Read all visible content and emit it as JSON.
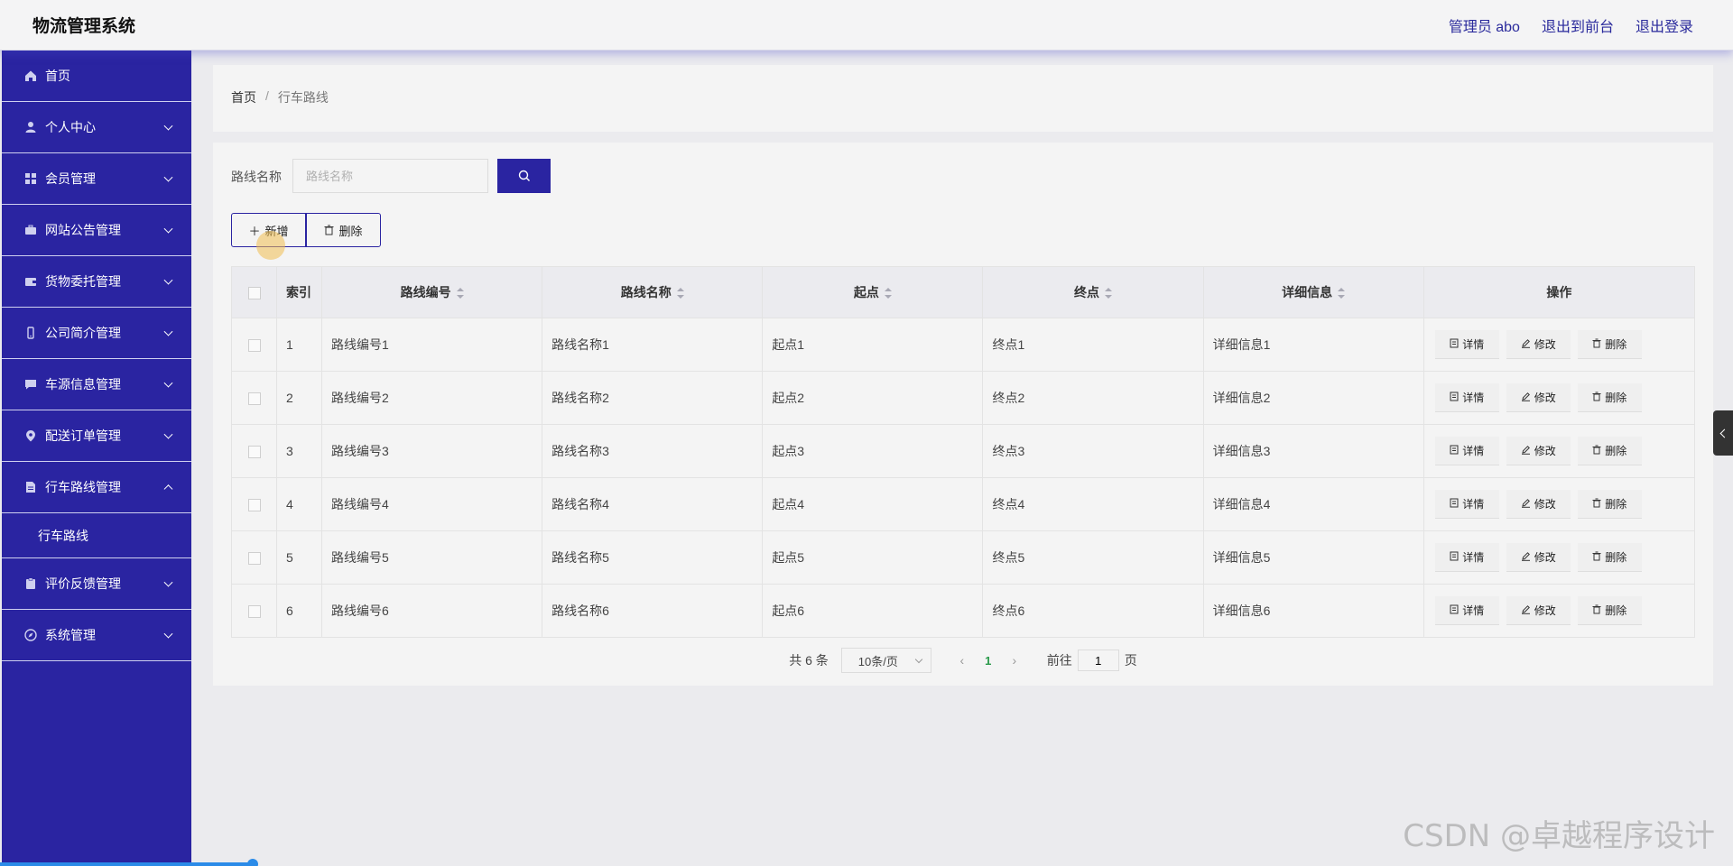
{
  "app": {
    "title": "物流管理系统"
  },
  "header": {
    "admin_label": "管理员 abo",
    "front_link": "退出到前台",
    "logout_link": "退出登录"
  },
  "sidebar": {
    "items": [
      {
        "label": "首页",
        "icon": "home-icon",
        "chevron": "none"
      },
      {
        "label": "个人中心",
        "icon": "user-icon",
        "chevron": "down"
      },
      {
        "label": "会员管理",
        "icon": "grid-icon",
        "chevron": "down"
      },
      {
        "label": "网站公告管理",
        "icon": "briefcase-icon",
        "chevron": "down"
      },
      {
        "label": "货物委托管理",
        "icon": "wallet-icon",
        "chevron": "down"
      },
      {
        "label": "公司简介管理",
        "icon": "phone-icon",
        "chevron": "down"
      },
      {
        "label": "车源信息管理",
        "icon": "message-icon",
        "chevron": "down"
      },
      {
        "label": "配送订单管理",
        "icon": "location-icon",
        "chevron": "down"
      },
      {
        "label": "行车路线管理",
        "icon": "document-icon",
        "chevron": "up"
      },
      {
        "label": "评价反馈管理",
        "icon": "clipboard-icon",
        "chevron": "down"
      },
      {
        "label": "系统管理",
        "icon": "compass-icon",
        "chevron": "down"
      }
    ],
    "submenu": {
      "label": "行车路线"
    }
  },
  "breadcrumb": {
    "home": "首页",
    "separator": "/",
    "current": "行车路线"
  },
  "search": {
    "label": "路线名称",
    "placeholder": "路线名称",
    "value": ""
  },
  "actions": {
    "add_label": "新增",
    "delete_label": "删除"
  },
  "table": {
    "headers": {
      "index": "索引",
      "route_no": "路线编号",
      "route_name": "路线名称",
      "start": "起点",
      "end": "终点",
      "detail": "详细信息",
      "ops": "操作"
    },
    "rows": [
      {
        "index": "1",
        "route_no": "路线编号1",
        "route_name": "路线名称1",
        "start": "起点1",
        "end": "终点1",
        "detail": "详细信息1"
      },
      {
        "index": "2",
        "route_no": "路线编号2",
        "route_name": "路线名称2",
        "start": "起点2",
        "end": "终点2",
        "detail": "详细信息2"
      },
      {
        "index": "3",
        "route_no": "路线编号3",
        "route_name": "路线名称3",
        "start": "起点3",
        "end": "终点3",
        "detail": "详细信息3"
      },
      {
        "index": "4",
        "route_no": "路线编号4",
        "route_name": "路线名称4",
        "start": "起点4",
        "end": "终点4",
        "detail": "详细信息4"
      },
      {
        "index": "5",
        "route_no": "路线编号5",
        "route_name": "路线名称5",
        "start": "起点5",
        "end": "终点5",
        "detail": "详细信息5"
      },
      {
        "index": "6",
        "route_no": "路线编号6",
        "route_name": "路线名称6",
        "start": "起点6",
        "end": "终点6",
        "detail": "详细信息6"
      }
    ],
    "row_actions": {
      "detail": "详情",
      "edit": "修改",
      "delete": "删除"
    }
  },
  "pagination": {
    "total": "共 6 条",
    "page_size": "10条/页",
    "current_page": "1",
    "goto_label": "前往",
    "goto_value": "1",
    "page_suffix": "页"
  },
  "watermark": "CSDN @卓越程序设计",
  "colors": {
    "primary": "#2a24a1",
    "background": "#ebebee",
    "card": "#f4f4f4",
    "pager_active": "#2a9a4a"
  }
}
